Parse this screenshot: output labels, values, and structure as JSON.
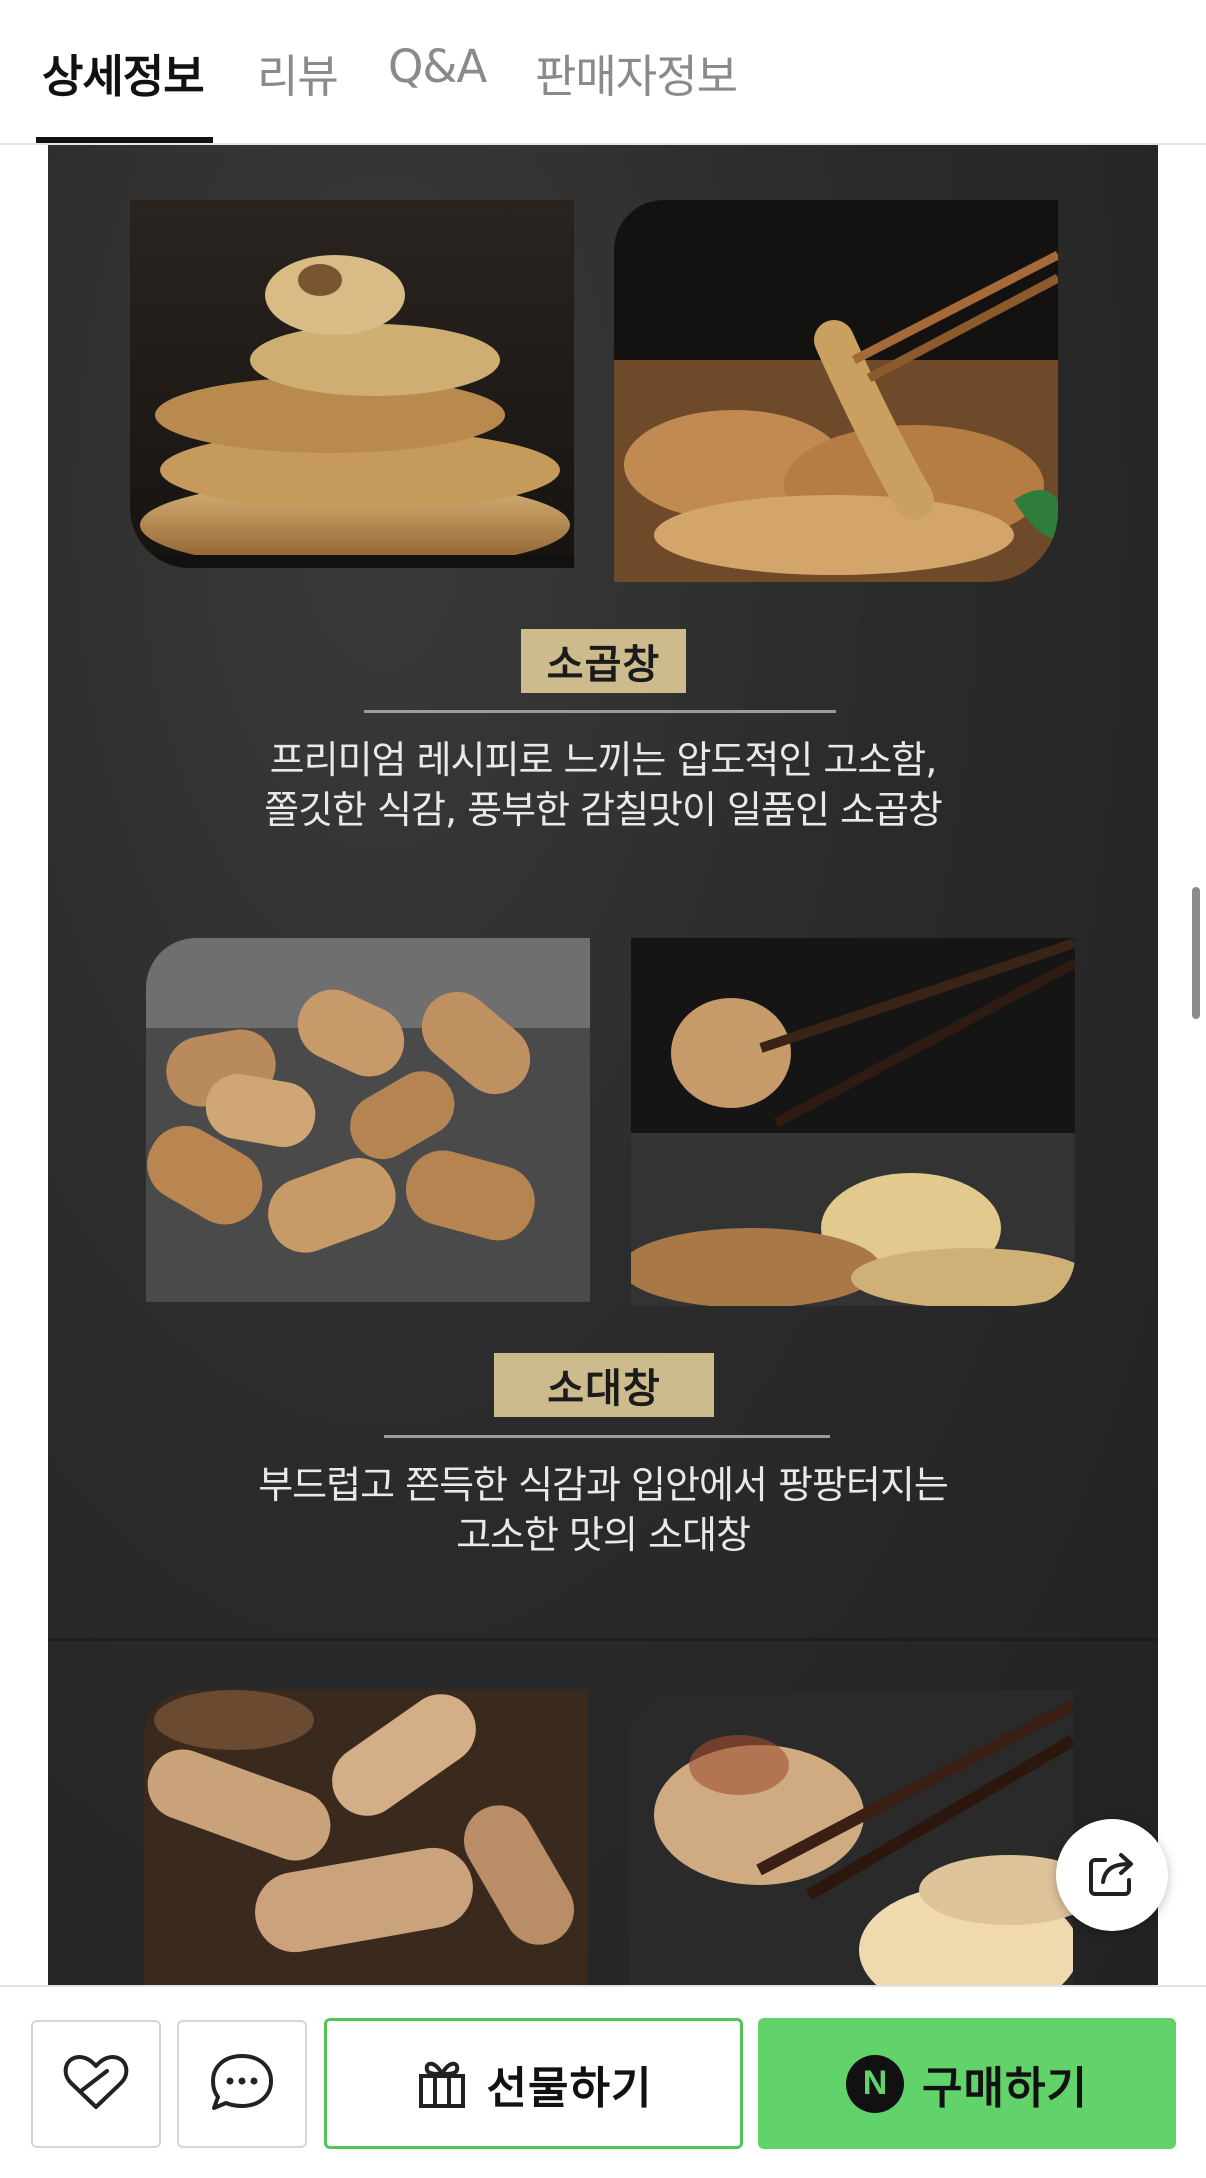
{
  "tabs": [
    {
      "label": "상세정보",
      "active": true
    },
    {
      "label": "리뷰",
      "active": false
    },
    {
      "label": "Q&A",
      "active": false
    },
    {
      "label": "판매자정보",
      "active": false
    }
  ],
  "sections": [
    {
      "title": "소곱창",
      "description_line1": "프리미엄 레시피로 느끼는 압도적인 고소함,",
      "description_line2": "쫄깃한 식감, 풍부한 감칠맛이 일품인 소곱창"
    },
    {
      "title": "소대창",
      "description_line1": "부드럽고 쫀득한 식감과 입안에서 팡팡터지는",
      "description_line2": "고소한 맛의 소대창"
    }
  ],
  "bottom_bar": {
    "gift_label": "선물하기",
    "buy_label": "구매하기",
    "buy_badge": "N"
  },
  "icons": {
    "wishlist": "heart-outline-icon",
    "talk": "chat-bubble-icon",
    "gift": "gift-icon",
    "share": "share-icon"
  },
  "colors": {
    "accent_green": "#62d26a",
    "gift_border": "#56c35a",
    "label_gold": "#cdbb8d",
    "panel_dark": "#2b2b2b"
  }
}
